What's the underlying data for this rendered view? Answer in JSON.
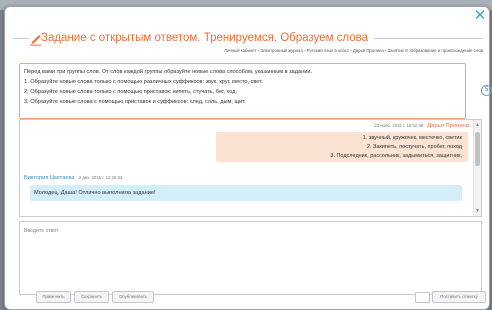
{
  "title": "Задание с открытым ответом. Тренируемся. Образуем слова",
  "breadcrumb": "Личный кабинет › Электронный журнал › Русский язык 6 класс › Дарья Пронина › Занятие 9. Образование и происхождение слов",
  "task": {
    "lines": [
      "Перед вами три группы слов. От слов каждой группы образуйте новые слова способом, указанным в задании.",
      "1. Образуйте новые слова только с помощью различных суффиксов: звук, круг, место, свет.",
      "2. Образуйте новые слова только с помощью приставок: кипеть, стучать, бег, ход.",
      "3. Образуйте новые слова с помощью приставок и суффиксов: след, соль, дым, щит."
    ],
    "counter": "5"
  },
  "messages": [
    {
      "date": "23 нояб. 2015 г. 15:52:38",
      "author": "Дарья Пронина",
      "lines": [
        "1. звучный, кружочек, местечко, светик",
        "2. Закипеть, постучать, пробег, поход",
        "3. Подследник, рассольник, задымиться, защитник,"
      ]
    },
    {
      "author": "Виктория Цветаева",
      "date": "2 дек. 2015 г. 12:26:02",
      "text": "Молодец, Даша! Отлично выполнила задание!"
    }
  ],
  "editor": {
    "placeholder": "Введите ответ"
  },
  "buttons": {
    "apply": "Применить",
    "save": "Сохранить",
    "publish": "Опубликовать",
    "grade": "Поставить отметку"
  },
  "colors": {
    "title_accent": "#e8733a",
    "student_bubble": "#fbe3d4",
    "teacher_bubble": "#d4eefa",
    "teacher_name": "#3a8fc0",
    "close_icon": "#3aa6cf"
  }
}
